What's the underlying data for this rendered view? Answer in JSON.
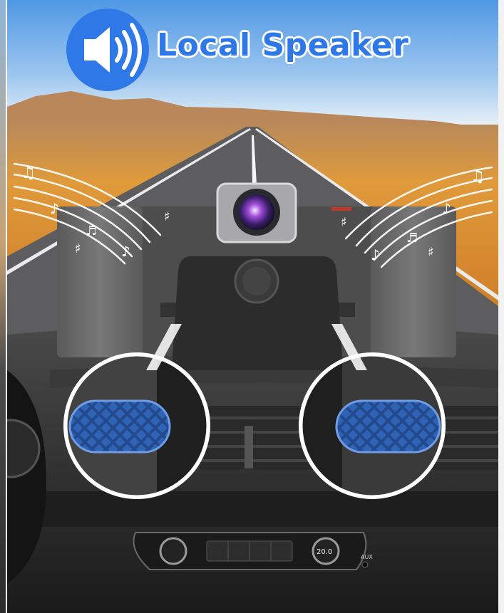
{
  "header": {
    "title": "Local Speaker",
    "icon": "speaker-icon"
  },
  "console": {
    "temperature": "20.0",
    "aux_label": "AUX"
  },
  "colors": {
    "accent": "#2f78e8",
    "sky_top": "#5aa0e6",
    "desert": "#d98a2e",
    "grille": "#2a4f8f"
  }
}
